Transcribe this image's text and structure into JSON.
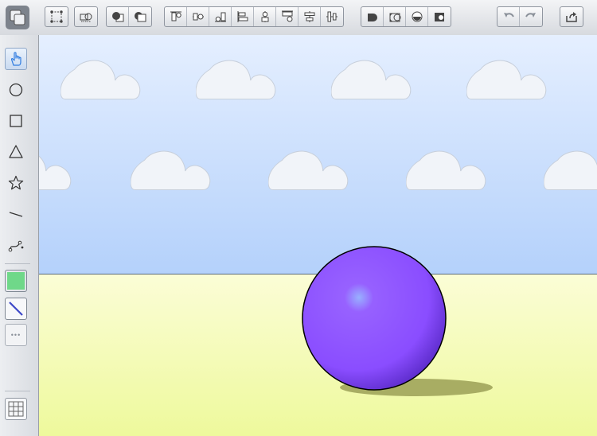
{
  "toolbar": {
    "app_icon": "canvas-layers-icon",
    "groups": [
      [
        "select-points-icon",
        "group-objects-icon"
      ],
      [
        "bring-front-icon",
        "send-back-icon"
      ],
      [
        "align-top-icon",
        "align-center-horizontal-icon",
        "align-bottom-icon",
        "align-left-icon",
        "align-middle-vertical-icon",
        "align-right-icon",
        "distribute-horizontal-icon",
        "distribute-vertical-icon"
      ],
      [
        "union-icon",
        "subtract-icon",
        "intersect-icon",
        "exclude-icon"
      ],
      [
        "undo-icon",
        "redo-icon"
      ],
      [
        "share-icon"
      ]
    ]
  },
  "sidebar": {
    "tools": [
      "hand-pointer-icon",
      "circle-tool-icon",
      "rectangle-tool-icon",
      "triangle-tool-icon",
      "star-tool-icon",
      "line-tool-icon",
      "bezier-tool-icon"
    ],
    "active_tool": "hand-pointer-icon",
    "fill_color": "#6fd889",
    "stroke_color": "#3e49c8",
    "more_label": "•••",
    "grid": "grid-icon"
  },
  "scene": {
    "sky_color": "#c9defc",
    "ground_color": "#f3f9b4",
    "ball_color": "#8a4dff",
    "cloud_color": "#f1f4f9"
  }
}
